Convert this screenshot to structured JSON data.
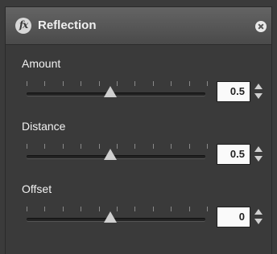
{
  "panel": {
    "icon": "fx-icon",
    "title": "Reflection",
    "fx_glyph": "fx",
    "close_icon": "close-icon"
  },
  "controls": [
    {
      "label": "Amount",
      "value": "0.5",
      "slider_level": 0.5
    },
    {
      "label": "Distance",
      "value": "0.5",
      "slider_level": 0.5
    },
    {
      "label": "Offset",
      "value": "0",
      "slider_level": 0.5
    }
  ],
  "colors": {
    "panel_bg": "#3a3a3a",
    "title_bar": "#555555",
    "text": "#f2f2f2",
    "value_box": "#fafafa"
  }
}
